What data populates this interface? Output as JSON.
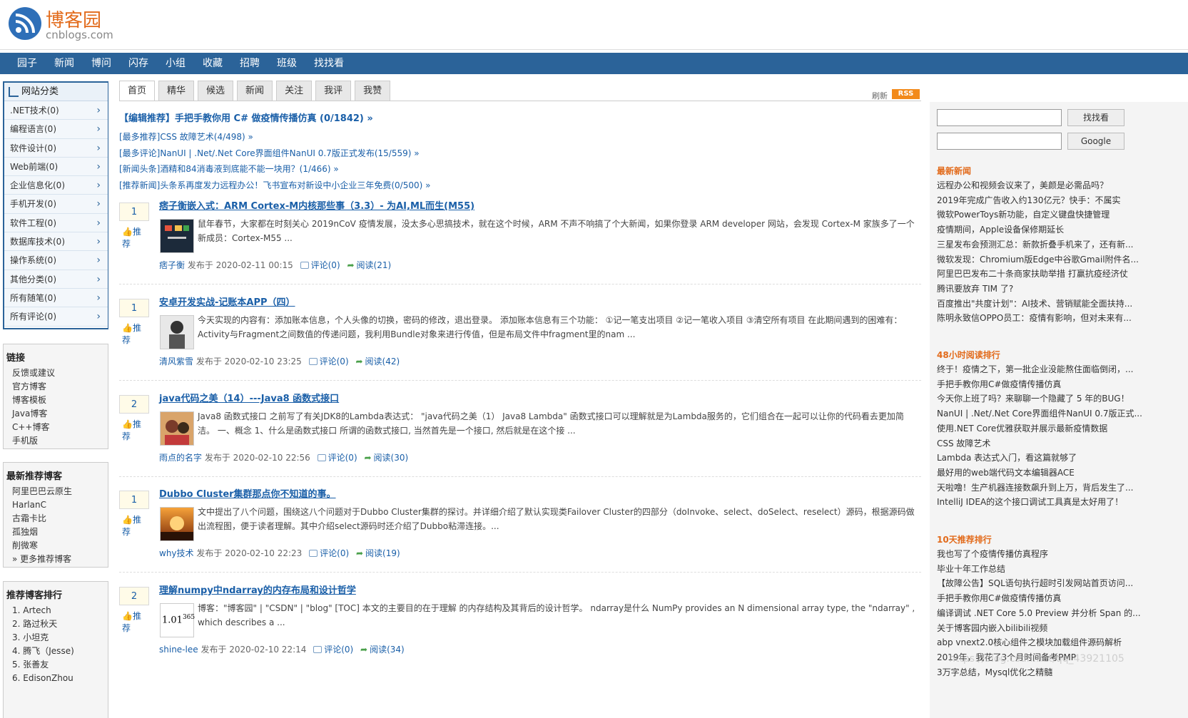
{
  "logo": {
    "cn": "博客园",
    "en": "cnblogs.com"
  },
  "nav": [
    "园子",
    "新闻",
    "博问",
    "闪存",
    "小组",
    "收藏",
    "招聘",
    "班级",
    "找找看"
  ],
  "categories": {
    "title": "网站分类",
    "items": [
      ".NET技术(0)",
      "编程语言(0)",
      "软件设计(0)",
      "Web前端(0)",
      "企业信息化(0)",
      "手机开发(0)",
      "软件工程(0)",
      "数据库技术(0)",
      "操作系统(0)",
      "其他分类(0)",
      "所有随笔(0)",
      "所有评论(0)"
    ]
  },
  "links": {
    "title": "链接",
    "items": [
      "反馈或建议",
      "官方博客",
      "博客模板",
      "Java博客",
      "C++博客",
      "手机版"
    ]
  },
  "recommended_bloggers": {
    "title": "最新推荐博客",
    "items": [
      "阿里巴巴云原生",
      "HarlanC",
      "古霜卡比",
      "孤独烟",
      "削微寒",
      "» 更多推荐博客"
    ]
  },
  "ranking": {
    "title": "推荐博客排行",
    "items": [
      "1. Artech",
      "2. 路过秋天",
      "3. 小坦克",
      "4. 腾飞（Jesse)",
      "5. 张善友",
      "6. EdisonZhou"
    ]
  },
  "tabs": [
    "首页",
    "精华",
    "候选",
    "新闻",
    "关注",
    "我评",
    "我赞"
  ],
  "refresh": "刷新",
  "rss": "RSS",
  "headlines": {
    "editor": "【编辑推荐】手把手教你用 C# 做疫情传播仿真 (0/1842) »",
    "items": [
      "[最多推荐]CSS 故障艺术(4/498) »",
      "[最多评论]NanUI | .Net/.Net Core界面组件NanUI 0.7版正式发布(15/559) »",
      "[新闻头条]酒精和84消毒液到底能不能一块用？(1/466) »",
      "[推荐新闻]头条系再度发力远程办公！飞书宣布对新设中小企业三年免费(0/500) »"
    ]
  },
  "vote_label": "推荐",
  "posts": [
    {
      "votes": "1",
      "title": "痞子衡嵌入式：ARM Cortex-M内核那些事（3.3）- 为AI,ML而生(M55)",
      "summary": "鼠年春节，大家都在时刻关心 2019nCoV 疫情发展，没太多心思搞技术，就在这个时候，ARM 不声不响搞了个大新闻，如果你登录 ARM developer 网站，会发现 Cortex-M 家族多了一个新成员：Cortex-M55 ...",
      "author": "痞子衡",
      "date": "发布于 2020-02-11 00:15",
      "comments": "评论(0)",
      "reads": "阅读(21)"
    },
    {
      "votes": "1",
      "title": "安卓开发实战-记账本APP（四）",
      "summary": "今天实现的内容有：添加账本信息，个人头像的切换，密码的修改，退出登录。 添加账本信息有三个功能： ①记一笔支出项目 ②记一笔收入项目 ③清空所有项目 在此期间遇到的困难有：Activity与Fragment之间数值的传递问题，我利用Bundle对象来进行传值，但是布局文件中fragment里的nam ...",
      "author": "清风紫雪",
      "date": "发布于 2020-02-10 23:25",
      "comments": "评论(0)",
      "reads": "阅读(42)"
    },
    {
      "votes": "2",
      "title": "java代码之美（14）---Java8 函数式接口",
      "summary": "Java8 函数式接口 之前写了有关JDK8的Lambda表达式： \"java代码之美（1） Java8 Lambda\" 函数式接口可以理解就是为Lambda服务的，它们组合在一起可以让你的代码看去更加简洁。 一、概念 1、什么是函数式接口 所谓的函数式接口, 当然首先是一个接口, 然后就是在这个接 ...",
      "author": "雨点的名字",
      "date": "发布于 2020-02-10 22:56",
      "comments": "评论(0)",
      "reads": "阅读(30)"
    },
    {
      "votes": "1",
      "title": "Dubbo Cluster集群那点你不知道的事。",
      "summary": "文中提出了八个问题，围绕这八个问题对于Dubbo Cluster集群的探讨。并详细介绍了默认实现类Failover Cluster的四部分（doInvoke、select、doSelect、reselect）源码，根据源码做出流程图，便于读者理解。其中介绍select源码时还介绍了Dubbo粘滞连接。...",
      "author": "why技术",
      "date": "发布于 2020-02-10 22:23",
      "comments": "评论(0)",
      "reads": "阅读(19)"
    },
    {
      "votes": "2",
      "title": "理解numpy中ndarray的内存布局和设计哲学",
      "summary": "博客：\"博客园\" | \"CSDN\" | \"blog\" [TOC] 本文的主要目的在于理解 的内存结构及其背后的设计哲学。 ndarray是什么 NumPy provides an N dimensional array type, the \"ndarray\" , which describes a ...",
      "author": "shine-lee",
      "date": "发布于 2020-02-10 22:14",
      "comments": "评论(0)",
      "reads": "阅读(34)",
      "thumb_text": "1.01",
      "thumb_sup": "365"
    }
  ],
  "search": {
    "button1": "找找看",
    "button2": "Google"
  },
  "latest_news": {
    "title": "最新新闻",
    "items": [
      "远程办公和视频会议来了，美颜是必需品吗？",
      "2019年完成广告收入约130亿元？快手：不属实",
      "微软PowerToys新功能，自定义键盘快捷管理",
      "疫情期间，Apple设备保修期延长",
      "三星发布会预测汇总：新款折叠手机来了，还有新...",
      "微软发现：Chromium版Edge中谷歌Gmail附件名...",
      "阿里巴巴发布二十条商家扶助举措 打赢抗疫经济仗",
      "腾讯要放弃 TIM 了?",
      "百度推出\"共度计划\"：AI技术、营销赋能全面扶持...",
      "陈明永致信OPPO员工：疫情有影响，但对未来有..."
    ]
  },
  "hot48": {
    "title": "48小时阅读排行",
    "items": [
      "终于！疫情之下，第一批企业没能熬住面临倒闭，...",
      "手把手教你用C#做疫情传播仿真",
      "今天你上班了吗？来聊聊一个隐藏了 5 年的BUG！",
      "NanUI | .Net/.Net Core界面组件NanUI 0.7版正式...",
      "使用.NET Core优雅获取并展示最新疫情数据",
      "CSS 故障艺术",
      "Lambda 表达式入门，看这篇就够了",
      "最好用的web端代码文本编辑器ACE",
      "天啦噜！生产机器连接数飙升到上万，背后发生了...",
      "IntelliJ IDEA的这个接口调试工具真是太好用了！"
    ]
  },
  "top10": {
    "title": "10天推荐排行",
    "items": [
      "我也写了个疫情传播仿真程序",
      "毕业十年工作总结",
      "【故障公告】SQL语句执行超时引发网站首页访问...",
      "手把手教你用C#做疫情传播仿真",
      "编译调试 .NET Core 5.0 Preview 并分析 Span 的...",
      "关于博客园内嵌入bilibili视频",
      "abp vnext2.0核心组件之模块加载组件源码解析",
      "2019年，我花了3个月时间备考PMP",
      "3万字总结，Mysql优化之精髓"
    ]
  },
  "watermark": "https://blog.csdn.net/qq_43921105"
}
